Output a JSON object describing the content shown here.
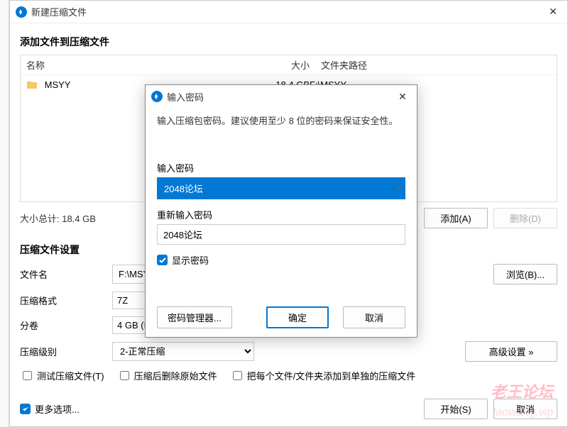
{
  "main_window": {
    "title": "新建压缩文件",
    "section_add": "添加文件到压缩文件",
    "columns": {
      "name": "名称",
      "size": "大小",
      "path": "文件夹路径"
    },
    "rows": [
      {
        "name": "MSYY",
        "size": "18.4 GB",
        "path": "F:\\MSYY"
      }
    ],
    "total_label": "大小总计: 18.4 GB",
    "add_btn": "添加(A)",
    "delete_btn": "删除(D)",
    "settings_label": "压缩文件设置",
    "filename_label": "文件名",
    "filename_value": "F:\\MSYY.7",
    "browse_btn": "浏览(B)...",
    "format_label": "压缩格式",
    "format_value": "7Z",
    "volume_label": "分卷",
    "volume_value": "4 GB (FAT",
    "level_label": "压缩级别",
    "level_value": "2-正常压缩",
    "advanced_btn": "高级设置 »",
    "check_test": "测试压缩文件(T)",
    "check_delete_after": "压缩后删除原始文件",
    "check_separate": "把每个文件/文件夹添加到单独的压缩文件",
    "more_options": "更多选项...",
    "start_btn": "开始(S)",
    "cancel_btn": "取消"
  },
  "modal": {
    "title": "输入密码",
    "hint": "输入压缩包密码。建议使用至少 8 位的密码来保证安全性。",
    "pwd_label": "输入密码",
    "pwd_value": "2048论坛",
    "pwd2_label": "重新输入密码",
    "pwd2_value": "2048论坛",
    "show_pwd": "显示密码",
    "pwd_manager": "密码管理器...",
    "ok": "确定",
    "cancel": "取消"
  },
  "watermark": {
    "line1": "老王论坛",
    "line2": "laowang.vip"
  }
}
